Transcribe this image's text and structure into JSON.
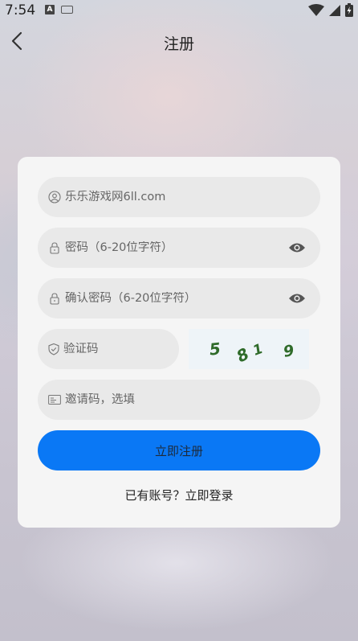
{
  "status_bar": {
    "time": "7:54"
  },
  "nav": {
    "title": "注册"
  },
  "form": {
    "username_placeholder": "乐乐游戏网6ll.com",
    "password_placeholder": "密码（6-20位字符）",
    "confirm_password_placeholder": "确认密码（6-20位字符）",
    "captcha_placeholder": "验证码",
    "captcha_digits": [
      "5",
      "8",
      "1",
      "9"
    ],
    "invite_placeholder": "邀请码，选填",
    "submit_label": "立即注册",
    "login_prompt": "已有账号？立即登录"
  },
  "colors": {
    "primary": "#0a78f5",
    "captcha_text": "#2f6b2a"
  }
}
